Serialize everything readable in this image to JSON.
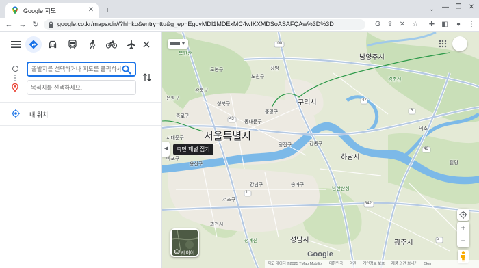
{
  "browser": {
    "tab_title": "Google 지도",
    "url": "google.co.kr/maps/dir//?hl=ko&entry=ttu&g_ep=EgoyMDI1MDExMC4wIKXMDSoASAFQAw%3D%3D"
  },
  "panel": {
    "start_placeholder": "출발지를 선택하거나 지도를 클릭하세요...",
    "destination_placeholder": "목적지를 선택하세요.",
    "my_location": "내 위치",
    "modes": [
      "경로",
      "자동차",
      "대중교통",
      "도보",
      "자전거",
      "항공편"
    ]
  },
  "map": {
    "tooltip": "측면 패널 접기",
    "layers_label": "레이어",
    "logo": "Google",
    "attribution": [
      "지도 데이터 ©2025 TMap Mobility",
      "대한민국",
      "약관",
      "개인정보 보호",
      "제품 의견 보내기",
      "5km"
    ],
    "labels": {
      "seoul": "서울특별시",
      "guri": "구리시",
      "hanam": "하남시",
      "seongnam": "성남시",
      "gwangju": "광주시",
      "namyangju": "남양주시",
      "jangam": "장암",
      "nowon": "노원구",
      "dobong": "도봉구",
      "gangbuk": "강북구",
      "seongbuk": "성북구",
      "jungnang": "중랑구",
      "gwangjin": "광진구",
      "gangdong": "강동구",
      "songpa": "송파구",
      "gangnam": "강남구",
      "seocho": "서초구",
      "jongno": "종로구",
      "jung": "중구",
      "yongsan": "용산구",
      "mapo": "마포구",
      "eunpyeong": "은평구",
      "seodaemun": "서대문구",
      "dongdaemun": "동대문구",
      "namhansanseong": "남한산성",
      "cheonggye": "청계산",
      "gwacheon": "과천시",
      "gyeongchun": "경춘선",
      "bukhansan": "북한산",
      "deokso": "덕소",
      "wondeok": "팔당"
    },
    "road_numbers": [
      "100",
      "43",
      "47",
      "6",
      "45",
      "342",
      "3",
      "1",
      "46"
    ]
  }
}
